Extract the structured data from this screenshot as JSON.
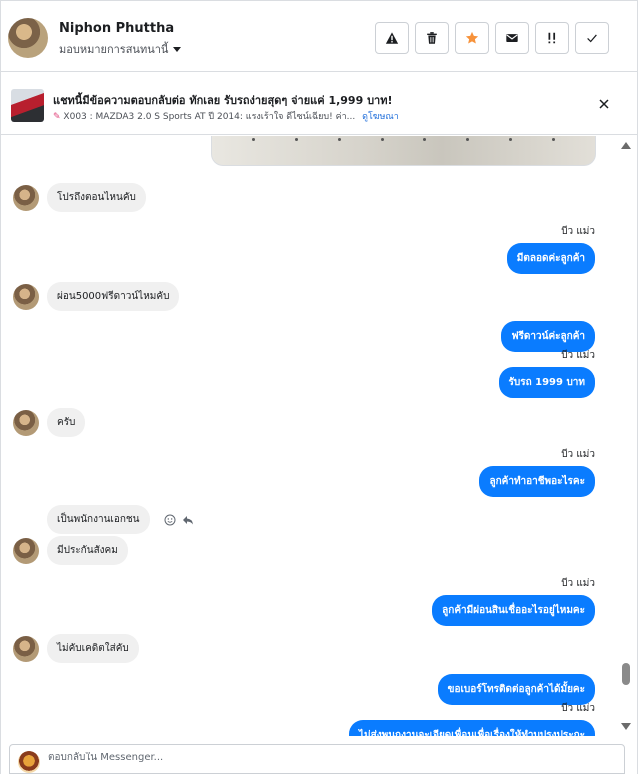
{
  "header": {
    "contact_name": "Niphon Phuttha",
    "assign_label": "มอบหมายการสนทนานี้",
    "toolbar": [
      {
        "name": "report-button",
        "icon": "warning-icon"
      },
      {
        "name": "delete-button",
        "icon": "trash-icon"
      },
      {
        "name": "star-button",
        "icon": "star-icon"
      },
      {
        "name": "mark-unread-button",
        "icon": "envelope-icon"
      },
      {
        "name": "spam-button",
        "icon": "exclamation-icon"
      },
      {
        "name": "mark-done-button",
        "icon": "check-icon"
      }
    ]
  },
  "banner": {
    "title": "แชทนี้มีข้อความตอบกลับต่อ ทักเลย รับรถง่ายสุดๆ จ่ายแค่ 1,999 บาท!",
    "subtitle": "X003 : MAZDA3 2.0 S Sports AT ปี 2014: แรงเร้าใจ ดีไซน์เฉียบ! ค่า...",
    "link": "ดูโฆษณา"
  },
  "messages": [
    {
      "dir": "in",
      "text": "โปรถึงตอนไหนคับ"
    },
    {
      "dir": "out",
      "sender": "บีว แม่ว",
      "text": "มีตลอดค่ะลูกค้า"
    },
    {
      "dir": "in",
      "text": "ผ่อน5000ฟรีดาวน์ไหมคับ"
    },
    {
      "dir": "out",
      "text": "ฟรีดาวน์ค่ะลูกค้า"
    },
    {
      "dir": "out",
      "sender": "บีว แม่ว",
      "text": "รับรถ 1999 บาท"
    },
    {
      "dir": "in",
      "text": "ครับ"
    },
    {
      "dir": "out",
      "sender": "บีว แม่ว",
      "text": "ลูกค้าทำอาชีพอะไรคะ"
    },
    {
      "dir": "in",
      "text": "เป็นพนักงานเอกชน"
    },
    {
      "dir": "in",
      "text": "มีประกันสังคม"
    },
    {
      "dir": "out",
      "sender": "บีว แม่ว",
      "text": "ลูกค้ามีผ่อนสินเชื่ออะไรอยู่ไหมคะ"
    },
    {
      "dir": "in",
      "text": "ไม่คับเคดิตใส่คับ"
    },
    {
      "dir": "out",
      "text": "ขอเบอร์โทรติดต่อลูกค้าได้มั้ยคะ"
    },
    {
      "dir": "out",
      "sender": "บีว แม่ว",
      "text": "ไม่ส่งพนกงานจะเจียดเพื่อนเพื่อเรื่องให้ทำบปรุงประกะ"
    }
  ],
  "composer": {
    "placeholder": "ตอบกลับใน Messenger..."
  },
  "colors": {
    "outgoing_bubble": "#0a7cff",
    "incoming_bubble": "#f0f0f0",
    "star": "#f7923a",
    "link": "#216fdb"
  }
}
